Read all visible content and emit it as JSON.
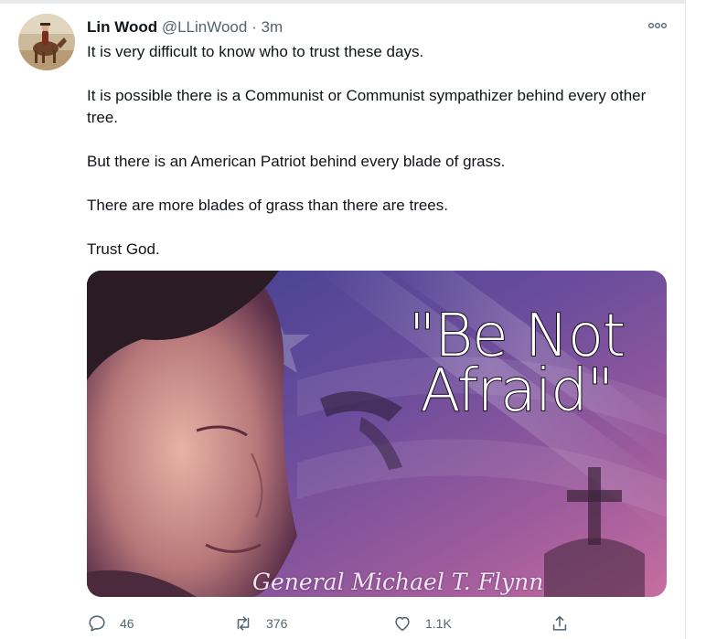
{
  "tweet": {
    "author_name": "Lin Wood",
    "author_handle": "@LLinWood",
    "separator": "·",
    "timestamp": "3m",
    "paragraphs": [
      "It is very difficult to know who to trust these days.",
      "It is possible there is a Communist or Communist sympathizer behind every other tree.",
      "But there is an American Patriot behind every blade of grass.",
      "There are more blades of grass than there are trees.",
      "Trust God."
    ],
    "media": {
      "quote_line1": "\"Be Not",
      "quote_line2": "Afraid\"",
      "signature": "General Michael T. Flynn"
    },
    "actions": {
      "reply_count": "46",
      "retweet_count": "376",
      "like_count": "1.1K"
    }
  },
  "icons": {
    "more": "more-options-icon",
    "reply": "reply-bubble-icon",
    "retweet": "retweet-icon",
    "like": "heart-icon",
    "share": "share-icon"
  },
  "colors": {
    "text_primary": "#0f1419",
    "text_secondary": "#536471",
    "border": "#e7e9ea"
  }
}
